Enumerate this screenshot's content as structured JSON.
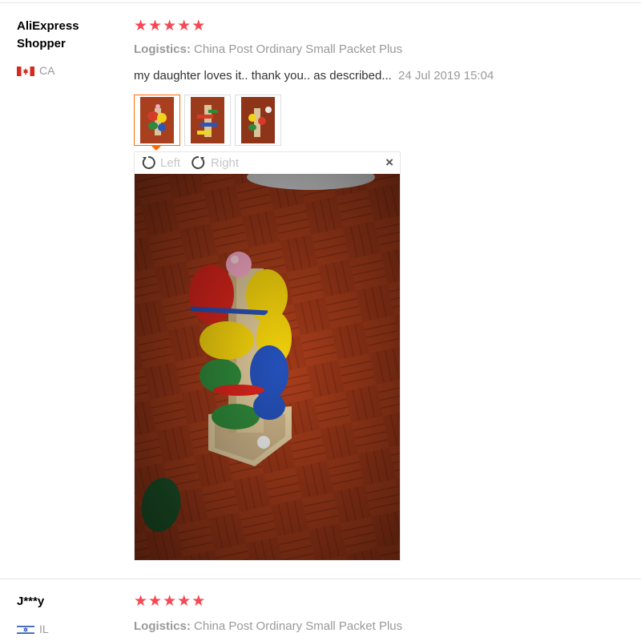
{
  "reviews": [
    {
      "user": "AliExpress Shopper",
      "country": "CA",
      "stars": 5,
      "logistics_label": "Logistics:",
      "logistics_value": "China Post Ordinary Small Packet Plus",
      "feedback": "my daughter loves it.. thank you.. as described...",
      "date": "24 Jul 2019 15:04",
      "viewer": {
        "rotate_left": "Left",
        "rotate_right": "Right",
        "close": "×"
      }
    },
    {
      "user": "J***y",
      "country": "IL",
      "stars": 5,
      "logistics_label": "Logistics:",
      "logistics_value": "China Post Ordinary Small Packet Plus"
    }
  ],
  "icons": {
    "star": "★",
    "rotate_left": "rotate-left-icon",
    "rotate_right": "rotate-right-icon",
    "close": "close-icon"
  },
  "colors": {
    "star": "#f44852",
    "accent": "#ff6a00",
    "muted": "#999999"
  }
}
